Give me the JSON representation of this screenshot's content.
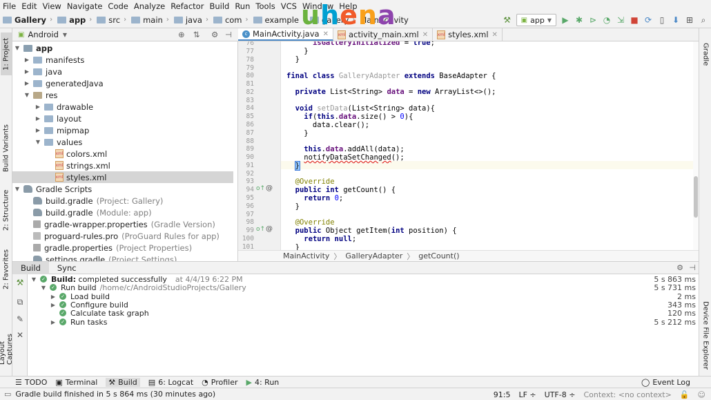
{
  "menu": [
    "File",
    "Edit",
    "View",
    "Navigate",
    "Code",
    "Analyze",
    "Refactor",
    "Build",
    "Run",
    "Tools",
    "VCS",
    "Window",
    "Help"
  ],
  "nav": {
    "crumbs": [
      "Gallery",
      "app",
      "src",
      "main",
      "java",
      "com",
      "example",
      "gallery",
      "MainActivity"
    ],
    "run_config": "app",
    "watermark": "uhena"
  },
  "colors": {
    "watermark": [
      "#6cb33f",
      "#00a0d2",
      "#f15a29",
      "#f9a01b",
      "#8e44ad"
    ],
    "accent": "#4a88c7",
    "success": "#59a869"
  },
  "left_tool": {
    "project": "1: Project",
    "build_variants": "Build Variants",
    "structure": "2: Structure",
    "favorites": "2: Favorites",
    "captures": "Layout Captures"
  },
  "right_tool": {
    "gradle": "Gradle",
    "device_explorer": "Device File Explorer"
  },
  "project": {
    "view": "Android",
    "tree": [
      {
        "label": "app",
        "bold": true
      },
      {
        "label": "manifests"
      },
      {
        "label": "java"
      },
      {
        "label": "generatedJava"
      },
      {
        "label": "res"
      },
      {
        "label": "drawable"
      },
      {
        "label": "layout"
      },
      {
        "label": "mipmap"
      },
      {
        "label": "values"
      },
      {
        "label": "colors.xml"
      },
      {
        "label": "strings.xml"
      },
      {
        "label": "styles.xml"
      },
      {
        "label": "Gradle Scripts"
      },
      {
        "label": "build.gradle",
        "note": "(Project: Gallery)"
      },
      {
        "label": "build.gradle",
        "note": "(Module: app)"
      },
      {
        "label": "gradle-wrapper.properties",
        "note": "(Gradle Version)"
      },
      {
        "label": "proguard-rules.pro",
        "note": "(ProGuard Rules for app)"
      },
      {
        "label": "gradle.properties",
        "note": "(Project Properties)"
      },
      {
        "label": "settings.gradle",
        "note": "(Project Settings)"
      }
    ]
  },
  "editor_tabs": [
    "MainActivity.java",
    "activity_main.xml",
    "styles.xml"
  ],
  "code": {
    "line_numbers": [
      "76",
      "77",
      "78",
      "79",
      "80",
      "81",
      "82",
      "83",
      "84",
      "85",
      "86",
      "87",
      "88",
      "89",
      "90",
      "91",
      "92",
      "93",
      "94",
      "95",
      "96",
      "97",
      "98",
      "99",
      "100",
      "101"
    ],
    "breadcrumbs": [
      "MainActivity",
      "GalleryAdapter",
      "getCount()"
    ]
  },
  "build": {
    "tabs": [
      "Build",
      "Sync"
    ],
    "rows": [
      {
        "label": "Build:",
        "rest": "completed successfully",
        "time_note": "at 4/4/19 6:22 PM",
        "time": "5 s 863 ms"
      },
      {
        "label": "Run build",
        "rest": "/home/c/AndroidStudioProjects/Gallery",
        "time": "5 s 731 ms"
      },
      {
        "label": "Load build",
        "time": "2 ms"
      },
      {
        "label": "Configure build",
        "time": "343 ms"
      },
      {
        "label": "Calculate task graph",
        "time": "120 ms"
      },
      {
        "label": "Run tasks",
        "time": "5 s 212 ms"
      }
    ]
  },
  "bottom_tabs": [
    "TODO",
    "Terminal",
    "Build",
    "6: Logcat",
    "Profiler",
    "4: Run",
    "Event Log"
  ],
  "status": {
    "message": "Gradle build finished in 5 s 864 ms (30 minutes ago)",
    "position": "91:5",
    "line_sep": "LF",
    "encoding": "UTF-8",
    "context": "Context: <no context>"
  }
}
